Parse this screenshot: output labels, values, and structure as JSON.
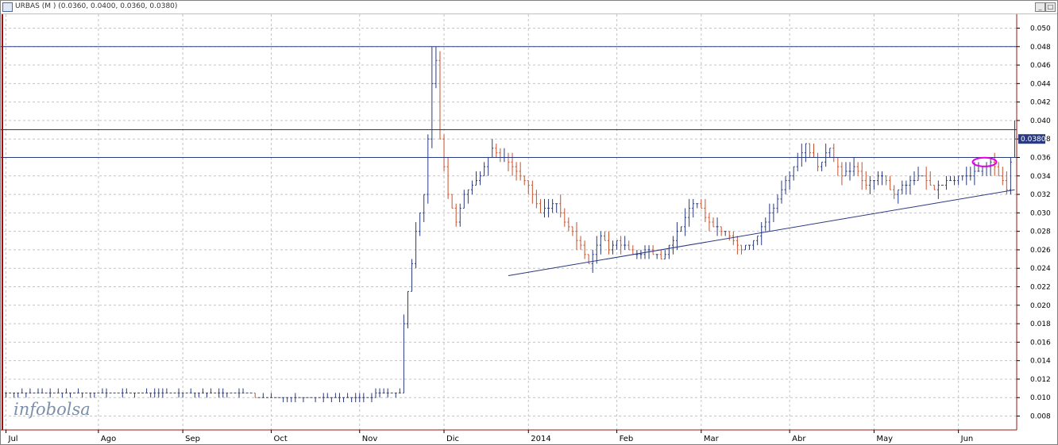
{
  "window": {
    "title": "URBAS (M ) (0.0360, 0.0400, 0.0360, 0.0380)",
    "minimize_glyph": "_",
    "maximize_glyph": "□"
  },
  "logo": {
    "part1": "info",
    "part2": "bolsa"
  },
  "chart_data": {
    "type": "ohlc",
    "ticker": "URBAS",
    "period": "M",
    "last_ohlc": {
      "open": 0.036,
      "high": 0.04,
      "low": 0.036,
      "close": 0.038
    },
    "last_price_label": "0.0380",
    "y_axis": {
      "ylim": [
        0.0065,
        0.0515
      ],
      "ticks": [
        "0.008",
        "0.010",
        "0.012",
        "0.014",
        "0.016",
        "0.018",
        "0.020",
        "0.022",
        "0.024",
        "0.026",
        "0.028",
        "0.030",
        "0.032",
        "0.034",
        "0.036",
        "0.038",
        "0.040",
        "0.042",
        "0.044",
        "0.046",
        "0.048",
        "0.050"
      ]
    },
    "x_axis": {
      "labels": [
        "Jul",
        "Ago",
        "Sep",
        "Oct",
        "Nov",
        "Dic",
        "2014",
        "Feb",
        "Mar",
        "Abr",
        "May",
        "Jun"
      ],
      "label_positions": [
        0,
        23,
        44,
        66,
        88,
        109,
        130,
        152,
        173,
        195,
        216,
        237
      ],
      "bar_count": 252
    },
    "grid": true,
    "colors": {
      "up": "#2a3a80",
      "down": "#c8502a",
      "resistance": "#2a3a80",
      "trendline": "#2a3a80",
      "highlight": "#e000e0",
      "axis_frame": "#a01010"
    },
    "horizontal_lines": [
      0.048,
      0.039,
      0.036
    ],
    "trendline": {
      "start": {
        "index": 125,
        "value": 0.0232
      },
      "end": {
        "index": 251,
        "value": 0.0325
      }
    },
    "highlight_ellipse": {
      "index": 243.5,
      "value": 0.0355
    },
    "price_anchors": [
      [
        0,
        0.0107
      ],
      [
        4,
        0.0105
      ],
      [
        60,
        0.0105
      ],
      [
        63,
        0.01
      ],
      [
        90,
        0.0102
      ],
      [
        98,
        0.0105
      ],
      [
        99,
        0.018
      ],
      [
        102,
        0.028
      ],
      [
        104,
        0.032
      ],
      [
        106,
        0.044
      ],
      [
        107,
        0.0465
      ],
      [
        108,
        0.038
      ],
      [
        110,
        0.032
      ],
      [
        112,
        0.029
      ],
      [
        114,
        0.032
      ],
      [
        118,
        0.034
      ],
      [
        121,
        0.037
      ],
      [
        126,
        0.035
      ],
      [
        130,
        0.033
      ],
      [
        133,
        0.03
      ],
      [
        137,
        0.031
      ],
      [
        139,
        0.029
      ],
      [
        141,
        0.028
      ],
      [
        145,
        0.0245
      ],
      [
        148,
        0.0275
      ],
      [
        150,
        0.026
      ],
      [
        152,
        0.027
      ],
      [
        156,
        0.0255
      ],
      [
        160,
        0.026
      ],
      [
        163,
        0.025
      ],
      [
        166,
        0.027
      ],
      [
        170,
        0.0305
      ],
      [
        172,
        0.031
      ],
      [
        176,
        0.0285
      ],
      [
        180,
        0.0275
      ],
      [
        183,
        0.026
      ],
      [
        186,
        0.027
      ],
      [
        189,
        0.029
      ],
      [
        192,
        0.0315
      ],
      [
        196,
        0.035
      ],
      [
        199,
        0.0375
      ],
      [
        202,
        0.035
      ],
      [
        205,
        0.037
      ],
      [
        208,
        0.034
      ],
      [
        211,
        0.035
      ],
      [
        214,
        0.033
      ],
      [
        218,
        0.034
      ],
      [
        221,
        0.032
      ],
      [
        225,
        0.0335
      ],
      [
        228,
        0.034
      ],
      [
        231,
        0.0325
      ],
      [
        235,
        0.0335
      ],
      [
        239,
        0.034
      ],
      [
        242,
        0.0345
      ],
      [
        245,
        0.0355
      ],
      [
        247,
        0.034
      ],
      [
        249,
        0.0325
      ],
      [
        250,
        0.0355
      ],
      [
        251,
        0.038
      ]
    ]
  }
}
